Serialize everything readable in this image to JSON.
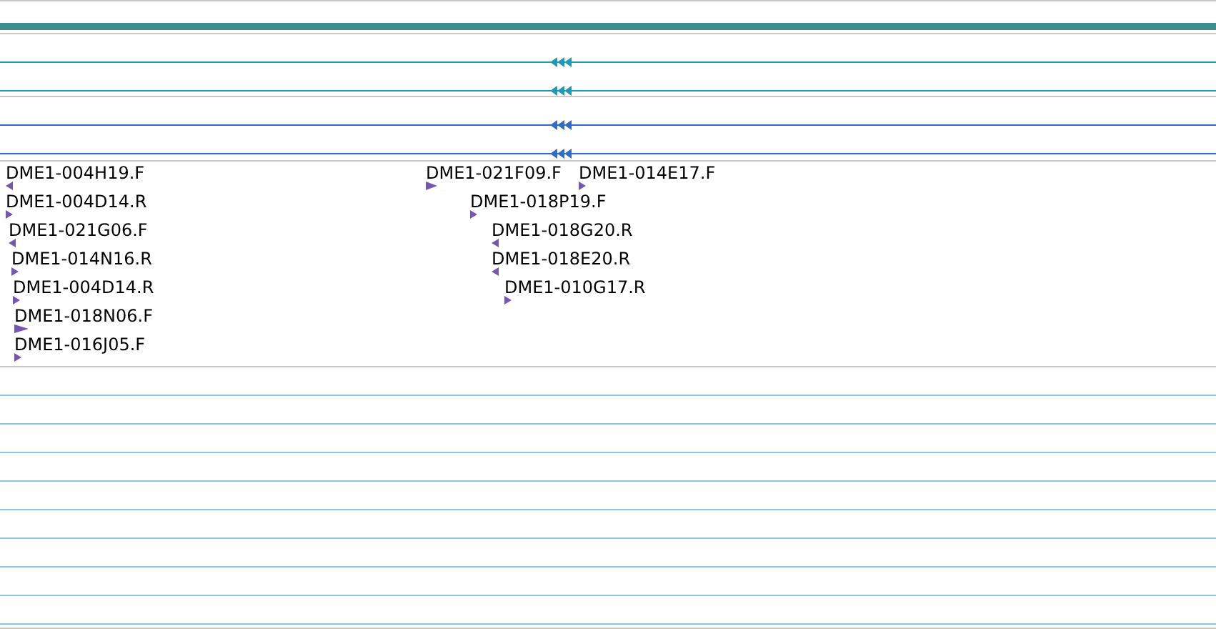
{
  "transcripts": [
    {
      "reverse": true,
      "color": "#1a9cb8"
    },
    {
      "reverse": true,
      "color": "#1a9cb8"
    },
    {
      "reverse": true,
      "color": "#2f6bc9"
    },
    {
      "reverse": true,
      "color": "#2f6bc9"
    }
  ],
  "features": [
    {
      "label": "DME1-004H19.F",
      "reverse": true
    },
    {
      "label": "DME1-004D14.R",
      "reverse": false
    },
    {
      "label": "DME1-021G06.F",
      "reverse": true
    },
    {
      "label": "DME1-014N16.R",
      "reverse": false
    },
    {
      "label": "DME1-004D14.R",
      "reverse": false
    },
    {
      "label": "DME1-018N06.F",
      "reverse": false
    },
    {
      "label": "DME1-016J05.F",
      "reverse": false
    },
    {
      "label": "DME1-021F09.F",
      "reverse": false
    },
    {
      "label": "DME1-014E17.F",
      "reverse": false
    },
    {
      "label": "DME1-018P19.F",
      "reverse": false
    },
    {
      "label": "DME1-018G20.R",
      "reverse": true
    },
    {
      "label": "DME1-018E20.R",
      "reverse": true
    },
    {
      "label": "DME1-010G17.R",
      "reverse": false
    }
  ]
}
